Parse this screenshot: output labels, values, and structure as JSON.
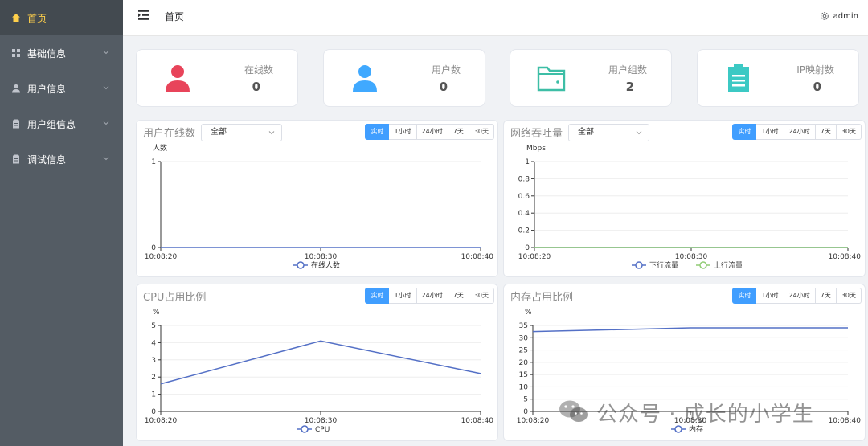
{
  "sidebar": {
    "items": [
      {
        "label": "首页",
        "icon": "home-icon",
        "active": true,
        "expandable": false
      },
      {
        "label": "基础信息",
        "icon": "grid-icon",
        "active": false,
        "expandable": true
      },
      {
        "label": "用户信息",
        "icon": "user-icon",
        "active": false,
        "expandable": true
      },
      {
        "label": "用户组信息",
        "icon": "document-icon",
        "active": false,
        "expandable": true
      },
      {
        "label": "调试信息",
        "icon": "document-icon",
        "active": false,
        "expandable": true
      }
    ],
    "active_color": "#ffd04b",
    "background": "#545c64"
  },
  "header": {
    "breadcrumb": "首页",
    "user": "admin"
  },
  "stats": [
    {
      "label": "在线数",
      "value": "0",
      "color": "#e8445a",
      "icon": "user-icon"
    },
    {
      "label": "用户数",
      "value": "0",
      "color": "#40a9ff",
      "icon": "user-icon"
    },
    {
      "label": "用户组数",
      "value": "2",
      "color": "#3dbea6",
      "icon": "folder-icon"
    },
    {
      "label": "IP映射数",
      "value": "0",
      "color": "#3cc9c4",
      "icon": "clipboard-icon"
    }
  ],
  "time_buttons": [
    "实时",
    "1小时",
    "24小时",
    "7天",
    "30天"
  ],
  "panels": [
    {
      "title": "用户在线数",
      "select": "全部"
    },
    {
      "title": "网络吞吐量",
      "select": "全部"
    },
    {
      "title": "CPU占用比例"
    },
    {
      "title": "内存占用比例"
    }
  ],
  "chart_data": [
    {
      "type": "line",
      "title": "用户在线数",
      "ylabel": "人数",
      "x": [
        "10:08:20",
        "10:08:30",
        "10:08:40"
      ],
      "yticks": [
        "0",
        "1"
      ],
      "ylim": [
        0,
        1
      ],
      "series": [
        {
          "name": "在线人数",
          "color": "#5470c6",
          "values": [
            0,
            0,
            0
          ]
        }
      ]
    },
    {
      "type": "line",
      "title": "网络吞吐量",
      "ylabel": "Mbps",
      "x": [
        "10:08:20",
        "10:08:30",
        "10:08:40"
      ],
      "yticks": [
        "0",
        "0.2",
        "0.4",
        "0.6",
        "0.8",
        "1"
      ],
      "ylim": [
        0,
        1
      ],
      "series": [
        {
          "name": "下行流量",
          "color": "#5470c6",
          "values": [
            0,
            0,
            0
          ]
        },
        {
          "name": "上行流量",
          "color": "#91cc75",
          "values": [
            0,
            0,
            0
          ]
        }
      ]
    },
    {
      "type": "line",
      "title": "CPU占用比例",
      "ylabel": "%",
      "x": [
        "10:08:20",
        "10:08:30",
        "10:08:40"
      ],
      "yticks": [
        "0",
        "1",
        "2",
        "3",
        "4",
        "5"
      ],
      "ylim": [
        0,
        5
      ],
      "series": [
        {
          "name": "CPU",
          "color": "#5470c6",
          "values": [
            1.6,
            4.1,
            2.2
          ]
        }
      ]
    },
    {
      "type": "line",
      "title": "内存占用比例",
      "ylabel": "%",
      "x": [
        "10:08:20",
        "10:08:30",
        "10:08:40"
      ],
      "yticks": [
        "0",
        "5",
        "10",
        "15",
        "20",
        "25",
        "30",
        "35"
      ],
      "ylim": [
        0,
        35
      ],
      "series": [
        {
          "name": "内存",
          "color": "#5470c6",
          "values": [
            32.5,
            34,
            34
          ]
        }
      ]
    }
  ],
  "watermark": "公众号 · 成长的小学生"
}
